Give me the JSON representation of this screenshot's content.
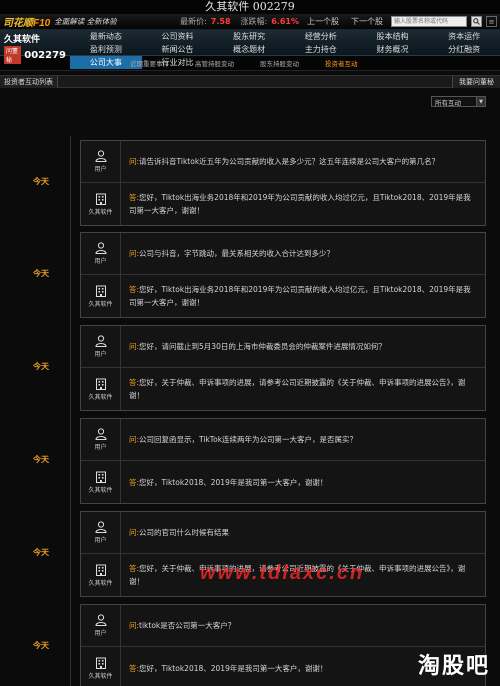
{
  "window_title": "久其软件 002279",
  "top_bar": {
    "logo_a": "司花顺",
    "logo_b": "F10",
    "slogan": "全面解读 全新体验",
    "latest_price_label": "最新价:",
    "latest_price": "7.58",
    "change_label": "涨跌幅:",
    "change_pct": "6.61%",
    "prev_stock": "上一个股",
    "next_stock": "下一个股",
    "search_placeholder": "输入股票名称或代码",
    "accent_red": "#ff3b3b"
  },
  "stock": {
    "name": "久其软件",
    "badge": "问董秘",
    "code": "002279"
  },
  "nav": [
    {
      "label": "最新动态",
      "active": false
    },
    {
      "label": "公司资料",
      "active": false
    },
    {
      "label": "股东研究",
      "active": false
    },
    {
      "label": "经营分析",
      "active": false
    },
    {
      "label": "股本结构",
      "active": false
    },
    {
      "label": "资本运作",
      "active": false
    },
    {
      "label": "盈利预测",
      "active": false
    },
    {
      "label": "新闻公告",
      "active": false
    },
    {
      "label": "概念题材",
      "active": false
    },
    {
      "label": "主力持仓",
      "active": false
    },
    {
      "label": "财务概况",
      "active": false
    },
    {
      "label": "分红融资",
      "active": false
    },
    {
      "label": "公司大事",
      "active": true
    },
    {
      "label": "行业对比",
      "active": false
    }
  ],
  "sub_nav": [
    {
      "label": "近期重要事件",
      "active": false
    },
    {
      "label": "高管持股变动",
      "active": false
    },
    {
      "label": "股东持股变动",
      "active": false
    },
    {
      "label": "投资者互动",
      "active": true
    }
  ],
  "section": {
    "tab": "投资者互动列表",
    "right": "我要问董秘"
  },
  "filter": {
    "selected": "所有互动"
  },
  "qa_items": [
    {
      "date": "今天",
      "q_role": "用户",
      "a_role": "久其软件",
      "q_prefix": "问:",
      "question": "请告诉抖音Tiktok近五年为公司贡献的收入是多少元？这五年连续是公司大客户的第几名？",
      "a_prefix": "答:",
      "answer": "您好，Tiktok出海业务2018年和2019年为公司贡献的收入均过亿元，且Tiktok2018、2019年是我司第一大客户，谢谢！"
    },
    {
      "date": "今天",
      "q_role": "用户",
      "a_role": "久其软件",
      "q_prefix": "问:",
      "question": "公司与抖音，字节跳动，最关系相关的收入合计达到多少？",
      "a_prefix": "答:",
      "answer": "您好，Tiktok出海业务2018年和2019年为公司贡献的收入均过亿元，且Tiktok2018、2019年是我司第一大客户，谢谢！"
    },
    {
      "date": "今天",
      "q_role": "用户",
      "a_role": "久其软件",
      "q_prefix": "问:",
      "question": "您好，请问截止到5月30日的上海市仲裁委员会的仲裁案件进展情况如何？",
      "a_prefix": "答:",
      "answer": "您好，关于仲裁、申诉事项的进展，请参考公司近期披露的《关于仲裁、申诉事项的进展公告》，谢谢！"
    },
    {
      "date": "今天",
      "q_role": "用户",
      "a_role": "久其软件",
      "q_prefix": "问:",
      "question": "公司回复函显示，TikTok连续两年为公司第一大客户，是否属实？",
      "a_prefix": "答:",
      "answer": "您好，Tiktok2018、2019年是我司第一大客户，谢谢！"
    },
    {
      "date": "今天",
      "q_role": "用户",
      "a_role": "久其软件",
      "q_prefix": "问:",
      "question": "公司的官司什么时候有结果",
      "a_prefix": "答:",
      "answer": "您好，关于仲裁、申诉事项的进展，请参考公司近期披露的《关于仲裁、申诉事项的进展公告》，谢谢！"
    },
    {
      "date": "今天",
      "q_role": "用户",
      "a_role": "久其软件",
      "q_prefix": "问:",
      "question": "tiktok是否公司第一大客户？",
      "a_prefix": "答:",
      "answer": "您好，Tiktok2018、2019年是我司第一大客户，谢谢！"
    }
  ],
  "watermark": "www.tdlaxc.cn",
  "site_mark": "淘股吧"
}
